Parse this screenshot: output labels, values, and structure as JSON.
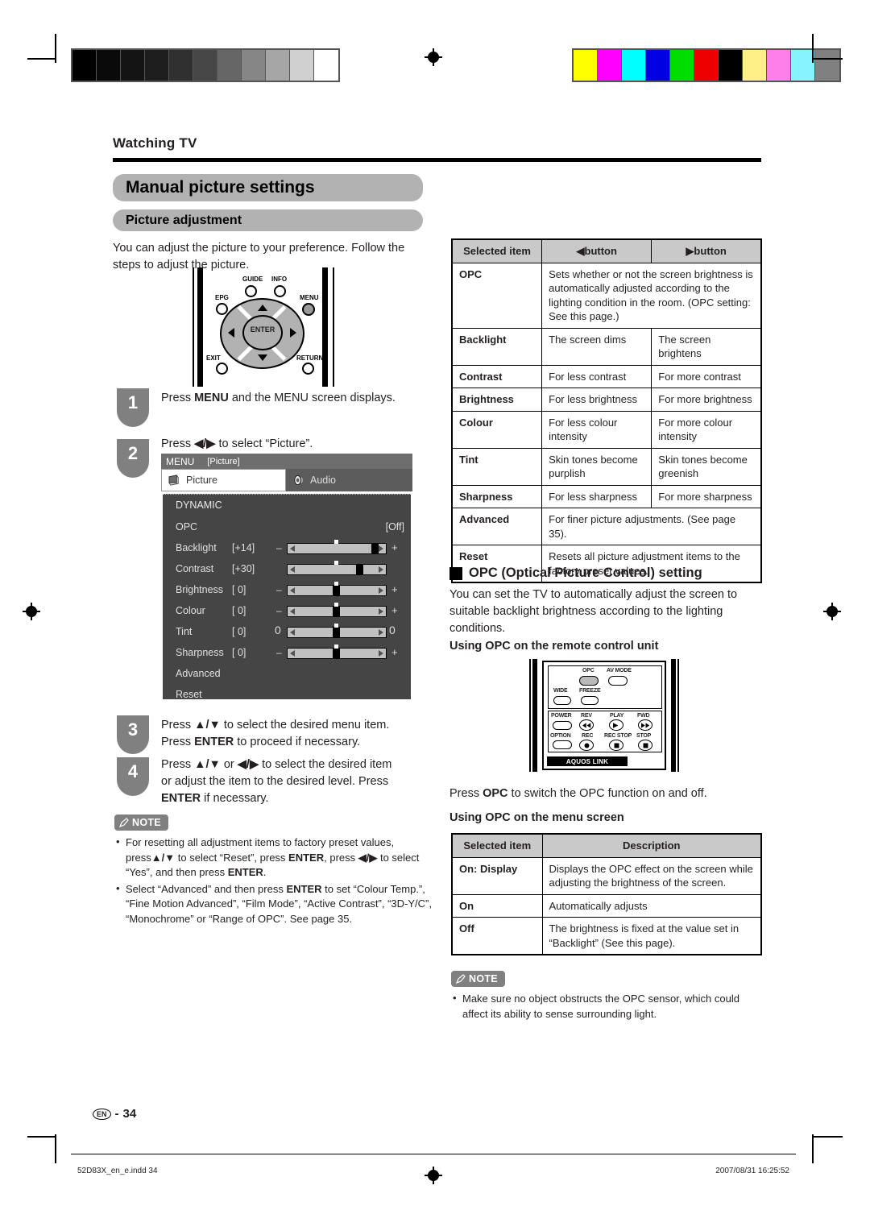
{
  "document": {
    "running_head": "Watching TV",
    "title": "Manual picture settings",
    "subtitle": "Picture adjustment",
    "intro": "You can adjust the picture to your preference. Follow the steps to adjust the picture.",
    "page_label": "EN",
    "page_number": "34",
    "footer_file": "52D83X_en_e.indd   34",
    "footer_timestamp": "2007/08/31   16:25:52"
  },
  "remote_top": {
    "labels": {
      "guide": "GUIDE",
      "info": "INFO",
      "epg": "EPG",
      "menu": "MENU",
      "exit": "EXIT",
      "return": "RETURN",
      "enter": "ENTER"
    }
  },
  "steps": [
    {
      "num": "1",
      "lines": [
        "Press MENU and the MENU screen displays."
      ]
    },
    {
      "num": "2",
      "lines": [
        "Press ◀/▶ to select “Picture”."
      ]
    },
    {
      "num": "3",
      "lines": [
        "Press ▲/▼ to select the desired menu item.",
        "Press ENTER to proceed if necessary."
      ]
    },
    {
      "num": "4",
      "lines": [
        "Press ▲/▼ or ◀/▶ to select the desired item",
        "or adjust the item to the desired level. Press",
        "ENTER if necessary."
      ]
    }
  ],
  "menu_screen": {
    "bar_title": "MENU",
    "bar_context": "[Picture]",
    "tabs": [
      {
        "label": "Picture",
        "icon": "picture-icon",
        "active": true
      },
      {
        "label": "Audio",
        "icon": "speaker-icon",
        "active": false
      }
    ],
    "mode": "DYNAMIC",
    "items": [
      {
        "name": "OPC",
        "value": "[Off]",
        "slider": false
      },
      {
        "name": "Backlight",
        "value": "[+14]",
        "slider": true,
        "percent": 88,
        "minus": "–",
        "plus": "+"
      },
      {
        "name": "Contrast",
        "value": "[+30]",
        "slider": true,
        "percent": 75,
        "minus": "",
        "plus": ""
      },
      {
        "name": "Brightness",
        "value": "[    0]",
        "slider": true,
        "percent": 50,
        "minus": "–",
        "plus": "+"
      },
      {
        "name": "Colour",
        "value": "[    0]",
        "slider": true,
        "percent": 50,
        "minus": "–",
        "plus": "+"
      },
      {
        "name": "Tint",
        "value": "[    0]",
        "slider": true,
        "percent": 50,
        "minus": "0",
        "plus": "0"
      },
      {
        "name": "Sharpness",
        "value": "[    0]",
        "slider": true,
        "percent": 50,
        "minus": "–",
        "plus": "+"
      },
      {
        "name": "Advanced",
        "value": "",
        "slider": false
      },
      {
        "name": "Reset",
        "value": "",
        "slider": false
      }
    ]
  },
  "note_left": {
    "badge": "NOTE",
    "items": [
      "For resetting all adjustment items to factory preset values, press▲/▼ to select “Reset”, press ENTER, press ◀/▶ to select “Yes”, and then press ENTER.",
      "Select “Advanced” and then press ENTER to set “Colour Temp.”, “Fine Motion Advanced”, “Film Mode”, “Active Contrast”, “3D-Y/C”, “Monochrome” or “Range of OPC”. See page 35."
    ]
  },
  "button_table": {
    "headers": [
      "Selected item",
      "◀button",
      "▶button"
    ],
    "rows": [
      {
        "item": "OPC",
        "span": true,
        "left": "Sets whether or not the screen brightness is automatically adjusted according to the lighting condition in the room. (OPC setting: See this page.)",
        "right": ""
      },
      {
        "item": "Backlight",
        "span": false,
        "left": "The screen dims",
        "right": "The screen brightens"
      },
      {
        "item": "Contrast",
        "span": false,
        "left": "For less contrast",
        "right": "For more contrast"
      },
      {
        "item": "Brightness",
        "span": false,
        "left": "For less brightness",
        "right": "For more brightness"
      },
      {
        "item": "Colour",
        "span": false,
        "left": "For less colour intensity",
        "right": "For more colour intensity"
      },
      {
        "item": "Tint",
        "span": false,
        "left": "Skin tones become purplish",
        "right": "Skin tones become greenish"
      },
      {
        "item": "Sharpness",
        "span": false,
        "left": "For less sharpness",
        "right": "For more sharpness"
      },
      {
        "item": "Advanced",
        "span": true,
        "left": "For finer picture adjustments. (See page 35).",
        "right": ""
      },
      {
        "item": "Reset",
        "span": true,
        "left": "Resets all picture adjustment items to the factory preset values.",
        "right": ""
      }
    ]
  },
  "opc_section": {
    "heading": "OPC (Optical Picture Control) setting",
    "body": "You can set the TV to automatically adjust the screen to suitable backlight brightness according to the lighting conditions.",
    "sub_remote": "Using OPC on the remote control unit",
    "press_line": "Press OPC to switch the OPC function on and off.",
    "sub_menu": "Using OPC on the menu screen"
  },
  "remote_bottom": {
    "buttons": [
      "OPC",
      "AV MODE",
      "WIDE",
      "FREEZE",
      "POWER",
      "REV",
      "PLAY",
      "FWD",
      "OPTION",
      "REC",
      "REC STOP",
      "STOP"
    ],
    "brand_bar": "AQUOS LINK"
  },
  "opc_table": {
    "headers": [
      "Selected item",
      "Description"
    ],
    "rows": [
      {
        "item": "On: Display",
        "desc": "Displays the OPC effect on the screen while adjusting the brightness of the screen."
      },
      {
        "item": "On",
        "desc": "Automatically adjusts"
      },
      {
        "item": "Off",
        "desc": "The brightness is fixed at the value set in “Backlight” (See this page)."
      }
    ]
  },
  "note_right": {
    "badge": "NOTE",
    "items": [
      "Make sure no object obstructs the OPC sensor, which could affect its ability to sense surrounding light."
    ]
  },
  "calibration": {
    "gray_ramp": [
      "#000000",
      "#0a0a0a",
      "#141414",
      "#1e1e1e",
      "#303030",
      "#474747",
      "#666666",
      "#868686",
      "#a6a6a6",
      "#d0d0d0",
      "#ffffff"
    ],
    "color_bars": [
      "#ffff00",
      "#ff00ff",
      "#00ffff",
      "#0000e0",
      "#00dd00",
      "#ee0000",
      "#000000",
      "#ffef86",
      "#ff7fe8",
      "#86f3ff",
      "#808080"
    ]
  }
}
